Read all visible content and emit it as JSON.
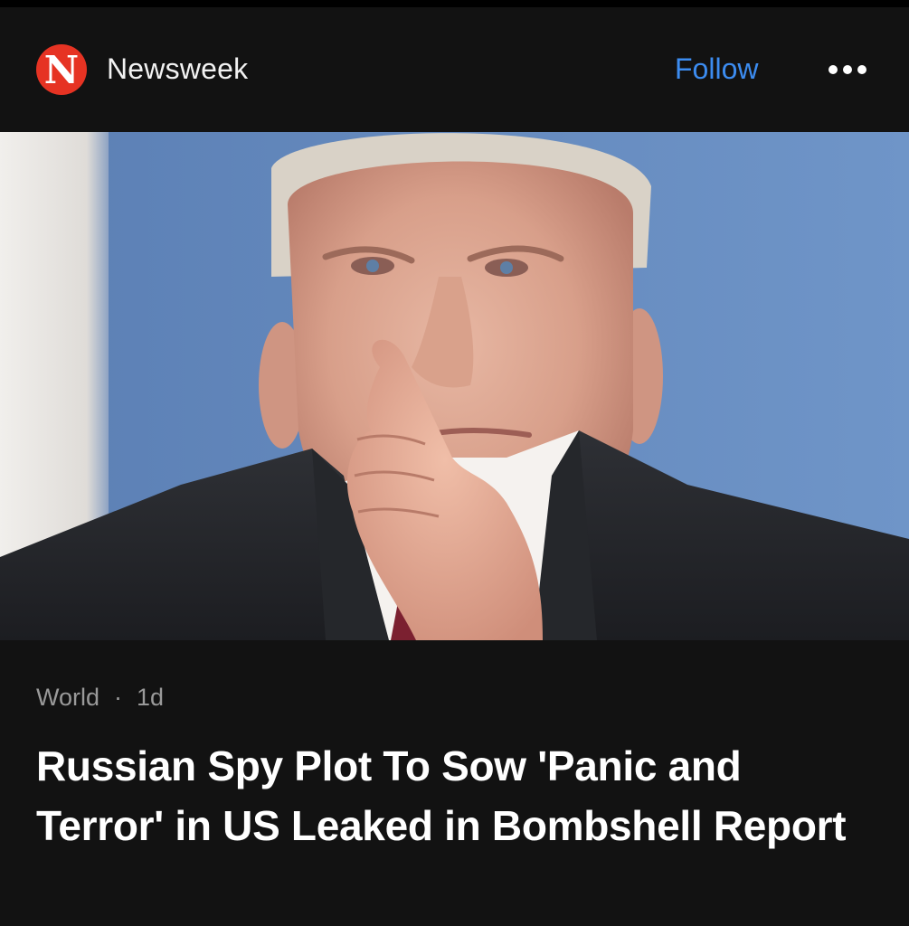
{
  "header": {
    "logo_letter": "N",
    "publisher_name": "Newsweek",
    "follow_label": "Follow",
    "more_icon": "more-horizontal-icon"
  },
  "article": {
    "category": "World",
    "separator": "·",
    "age": "1d",
    "headline": "Russian Spy Plot To Sow 'Panic and Terror' in US Leaked in Bombshell Report"
  },
  "colors": {
    "background": "#121212",
    "accent_follow": "#3c8cf0",
    "logo_red": "#e63323",
    "meta_text": "#9a9a9a"
  }
}
